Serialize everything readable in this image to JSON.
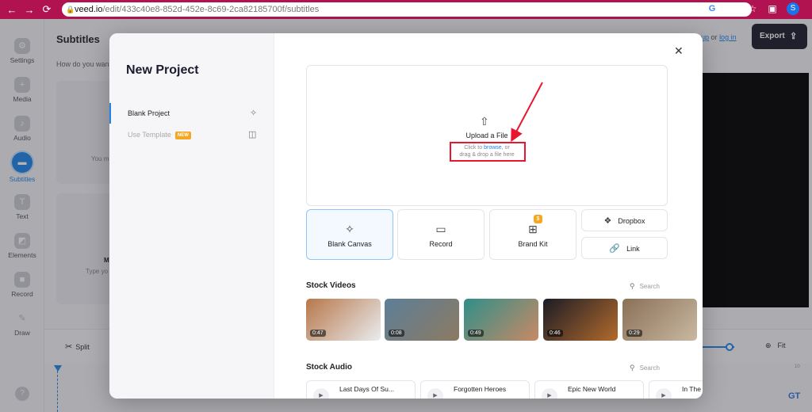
{
  "browser": {
    "url_host": "veed.io",
    "url_path": "/edit/433c40e8-852d-452e-8c69-2ca82185700f/subtitles",
    "avatar_letter": "S"
  },
  "rail": {
    "items": [
      {
        "label": "Settings",
        "icon": "gear-icon"
      },
      {
        "label": "Media",
        "icon": "plus-icon"
      },
      {
        "label": "Audio",
        "icon": "music-note-icon"
      },
      {
        "label": "Subtitles",
        "icon": "subtitles-icon"
      },
      {
        "label": "Text",
        "icon": "text-icon"
      },
      {
        "label": "Elements",
        "icon": "shapes-icon"
      },
      {
        "label": "Record",
        "icon": "camera-icon"
      },
      {
        "label": "Draw",
        "icon": "pen-icon"
      }
    ],
    "active": "Subtitles",
    "help": "?"
  },
  "background": {
    "title": "Subtitles",
    "question": "How do you wan",
    "card1_text": "You m",
    "card2_title": "M",
    "card2_text": "Type yo",
    "signup_link": "up",
    "or": "or",
    "login_link": "log in",
    "export_label": "Export",
    "split_label": "Split",
    "fit_label": "Fit",
    "timeline_num": "10"
  },
  "modal": {
    "title": "New Project",
    "nav": [
      {
        "label": "Blank Project",
        "icon": "sparkle-icon",
        "active": true
      },
      {
        "label": "Use Template",
        "icon": "template-icon",
        "badge": "NEW"
      }
    ],
    "upload": {
      "title": "Upload a File",
      "hint_prefix": "Click to",
      "hint_link": "browse",
      "hint_suffix": ", or",
      "hint_line2": "drag & drop a file here"
    },
    "options": {
      "blank_canvas": "Blank Canvas",
      "record": "Record",
      "brand_kit": "Brand Kit",
      "brand_kit_badge": "$",
      "dropbox": "Dropbox",
      "link": "Link"
    },
    "stock_videos": {
      "title": "Stock Videos",
      "search_placeholder": "Search",
      "items": [
        {
          "duration": "0:47",
          "colors": [
            "#b8774a",
            "#e9ecef"
          ]
        },
        {
          "duration": "0:08",
          "colors": [
            "#5c7f99",
            "#8d7a61"
          ]
        },
        {
          "duration": "0:49",
          "colors": [
            "#2f8f8a",
            "#c98964"
          ]
        },
        {
          "duration": "0:46",
          "colors": [
            "#1b1c25",
            "#b36a2c"
          ]
        },
        {
          "duration": "0:29",
          "colors": [
            "#8a7158",
            "#c9b8a0"
          ]
        }
      ]
    },
    "stock_audio": {
      "title": "Stock Audio",
      "search_placeholder": "Search",
      "items": [
        "Last Days Of Su...",
        "Forgotten Heroes",
        "Epic New World",
        "In The"
      ]
    }
  },
  "watermark": "GT"
}
